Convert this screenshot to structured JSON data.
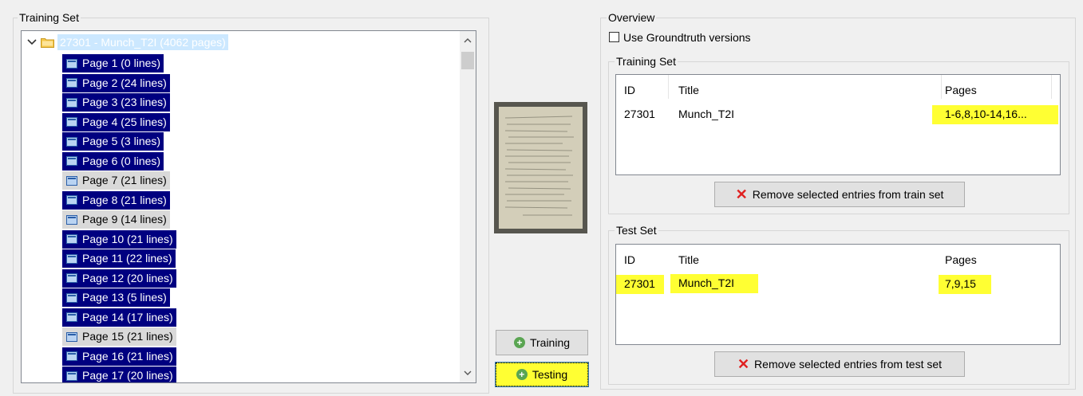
{
  "left_panel": {
    "title": "Training Set",
    "root": {
      "label": "27301 - Munch_T2I (4062 pages)"
    },
    "pages": [
      {
        "label": "Page 1 (0 lines)",
        "selected": true
      },
      {
        "label": "Page 2 (24 lines)",
        "selected": true
      },
      {
        "label": "Page 3 (23 lines)",
        "selected": true
      },
      {
        "label": "Page 4 (25 lines)",
        "selected": true
      },
      {
        "label": "Page 5 (3 lines)",
        "selected": true
      },
      {
        "label": "Page 6 (0 lines)",
        "selected": true
      },
      {
        "label": "Page 7 (21 lines)",
        "selected": false
      },
      {
        "label": "Page 8 (21 lines)",
        "selected": true
      },
      {
        "label": "Page 9 (14 lines)",
        "selected": false
      },
      {
        "label": "Page 10 (21 lines)",
        "selected": true
      },
      {
        "label": "Page 11 (22 lines)",
        "selected": true
      },
      {
        "label": "Page 12 (20 lines)",
        "selected": true
      },
      {
        "label": "Page 13 (5 lines)",
        "selected": true
      },
      {
        "label": "Page 14 (17 lines)",
        "selected": true
      },
      {
        "label": "Page 15 (21 lines)",
        "selected": false
      },
      {
        "label": "Page 16 (21 lines)",
        "selected": true
      },
      {
        "label": "Page 17 (20 lines)",
        "selected": true
      }
    ]
  },
  "middle": {
    "training_button": "Training",
    "testing_button": "Testing"
  },
  "overview": {
    "title": "Overview",
    "use_groundtruth_label": "Use Groundtruth versions",
    "training_set": {
      "title": "Training Set",
      "headers": [
        "ID",
        "Title",
        "Pages"
      ],
      "rows": [
        {
          "id": "27301",
          "title": "Munch_T2I",
          "pages": "1-6,8,10-14,16..."
        }
      ],
      "remove_button": "Remove selected entries from train set"
    },
    "test_set": {
      "title": "Test Set",
      "headers": [
        "ID",
        "Title",
        "Pages"
      ],
      "rows": [
        {
          "id": "27301",
          "title": "Munch_T2I",
          "pages": "7,9,15"
        }
      ],
      "remove_button": "Remove selected entries from test set"
    }
  },
  "colors": {
    "selection": "#000080",
    "highlight": "#ffff33",
    "accent_green": "#5aa552",
    "remove_red": "#e02020"
  }
}
